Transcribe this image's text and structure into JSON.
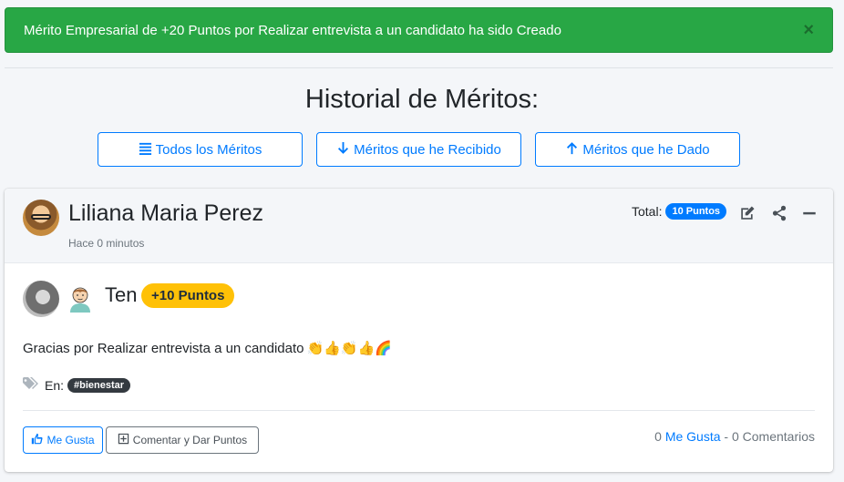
{
  "alert": {
    "message": "Mérito Empresarial de +20 Puntos por Realizar entrevista a un candidato ha sido Creado",
    "close": "×",
    "color": "#28a745"
  },
  "page": {
    "title": "Historial de Méritos:"
  },
  "filters": {
    "all": "Todos los Méritos",
    "received": "Méritos que he Recibido",
    "given": "Méritos que he Dado",
    "accent": "#007bff"
  },
  "merit": {
    "author": "Liliana Maria Perez",
    "time": "Hace 0 minutos",
    "total_label": "Total:",
    "total_badge": "10 Puntos",
    "receiver": "Ten",
    "points": "+10 Puntos",
    "message": "Gracias por Realizar entrevista a un candidato",
    "emojis": "👏👍👏👍🌈",
    "tags_label": "En:",
    "tag": "#bienestar",
    "like_button": "Me Gusta",
    "comment_button": "Comentar y Dar Puntos",
    "likes_count": "0",
    "likes_label": "Me Gusta",
    "comments_text": "- 0 Comentarios",
    "badge_color": "#ffc107"
  }
}
